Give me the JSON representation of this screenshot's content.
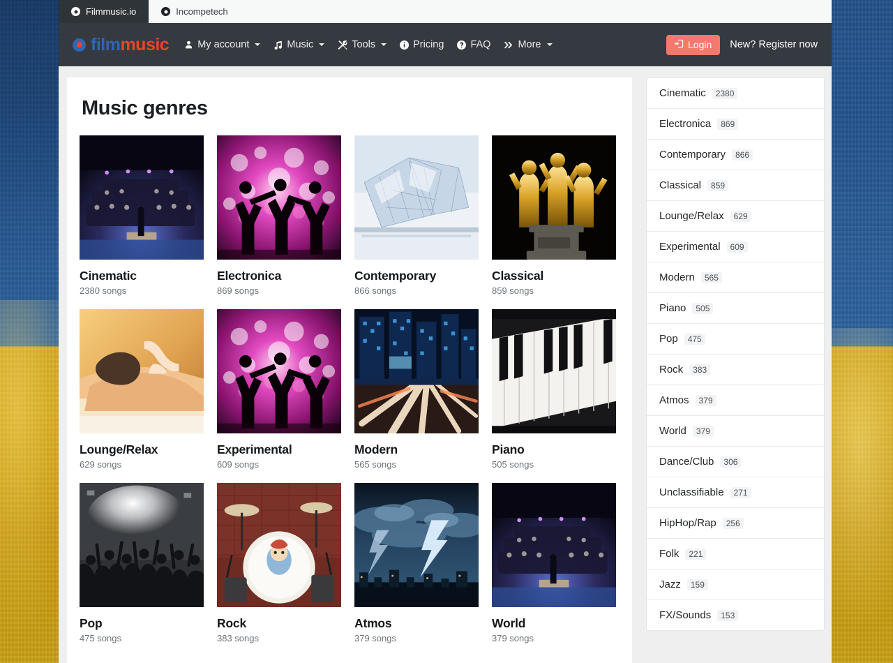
{
  "browser": {
    "tabs": [
      {
        "title": "Filmmusic.io",
        "favicon": "record-icon",
        "active": true
      },
      {
        "title": "Incompetech",
        "favicon": "record-icon",
        "active": false
      }
    ]
  },
  "navbar": {
    "logo": {
      "mark": "record-icon",
      "part1": "film",
      "part2": "music"
    },
    "links": [
      {
        "label": "My account",
        "icon": "user-icon",
        "caret": true
      },
      {
        "label": "Music",
        "icon": "music-note-icon",
        "caret": true
      },
      {
        "label": "Tools",
        "icon": "tools-icon",
        "caret": true
      },
      {
        "label": "Pricing",
        "icon": "info-circle-icon",
        "caret": false
      },
      {
        "label": "FAQ",
        "icon": "question-circle-icon",
        "caret": false
      },
      {
        "label": "More",
        "icon": "chevron-double-right-icon",
        "caret": true
      }
    ],
    "login_label": "Login",
    "login_icon": "sign-in-icon",
    "login_color": "#f2796b",
    "register_label": "New? Register now"
  },
  "main": {
    "title": "Music genres",
    "count_suffix": "songs",
    "genres": [
      {
        "name": "Cinematic",
        "count": "2380",
        "count_label": "2380 songs",
        "image": "orchestra-stage-photo"
      },
      {
        "name": "Electronica",
        "count": "869",
        "count_label": "869 songs",
        "image": "dancers-bokeh-photo"
      },
      {
        "name": "Contemporary",
        "count": "866",
        "count_label": "866 songs",
        "image": "glass-architecture-photo"
      },
      {
        "name": "Classical",
        "count": "859",
        "count_label": "859 songs",
        "image": "golden-statues-photo"
      },
      {
        "name": "Lounge/Relax",
        "count": "629",
        "count_label": "629 songs",
        "image": "spa-massage-photo"
      },
      {
        "name": "Experimental",
        "count": "609",
        "count_label": "609 songs",
        "image": "dancers-bokeh-photo"
      },
      {
        "name": "Modern",
        "count": "565",
        "count_label": "565 songs",
        "image": "city-night-traffic-photo"
      },
      {
        "name": "Piano",
        "count": "505",
        "count_label": "505 songs",
        "image": "piano-keys-photo"
      },
      {
        "name": "Pop",
        "count": "475",
        "count_label": "475 songs",
        "image": "concert-crowd-photo"
      },
      {
        "name": "Rock",
        "count": "383",
        "count_label": "383 songs",
        "image": "drum-kit-photo"
      },
      {
        "name": "Atmos",
        "count": "379",
        "count_label": "379 songs",
        "image": "lightning-storm-photo"
      },
      {
        "name": "World",
        "count": "379",
        "count_label": "379 songs",
        "image": "orchestra-stage-photo"
      }
    ]
  },
  "sidebar": {
    "items": [
      {
        "label": "Cinematic",
        "count": "2380"
      },
      {
        "label": "Electronica",
        "count": "869"
      },
      {
        "label": "Contemporary",
        "count": "866"
      },
      {
        "label": "Classical",
        "count": "859"
      },
      {
        "label": "Lounge/Relax",
        "count": "629"
      },
      {
        "label": "Experimental",
        "count": "609"
      },
      {
        "label": "Modern",
        "count": "565"
      },
      {
        "label": "Piano",
        "count": "505"
      },
      {
        "label": "Pop",
        "count": "475"
      },
      {
        "label": "Rock",
        "count": "383"
      },
      {
        "label": "Atmos",
        "count": "379"
      },
      {
        "label": "World",
        "count": "379"
      },
      {
        "label": "Dance/Club",
        "count": "306"
      },
      {
        "label": "Unclassifiable",
        "count": "271"
      },
      {
        "label": "HipHop/Rap",
        "count": "256"
      },
      {
        "label": "Folk",
        "count": "221"
      },
      {
        "label": "Jazz",
        "count": "159"
      },
      {
        "label": "FX/Sounds",
        "count": "153"
      }
    ]
  }
}
